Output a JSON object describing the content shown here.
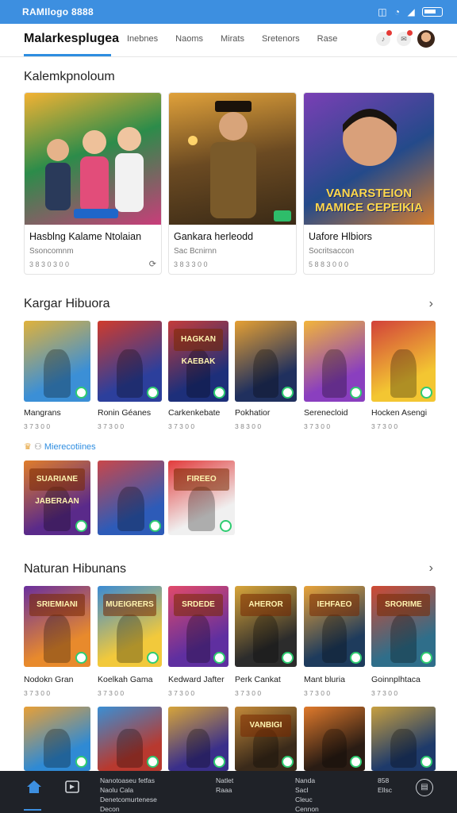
{
  "statusbar": {
    "left_text": "RAMIlogo 8888"
  },
  "brand": {
    "name": "Malarkesplugea"
  },
  "nav": {
    "links": [
      "Inebnes",
      "Naoms",
      "Mirats",
      "Sretenors",
      "Rase"
    ]
  },
  "featured": {
    "title": "Kalemkpnoloum",
    "cards": [
      {
        "title": "Hasblng Kalame Ntolaian",
        "sub": "Ssoncomnm",
        "meta": "3 8 3 0 3 0 0",
        "art_text": "",
        "colors": [
          "#2c8c4a",
          "#f3b233",
          "#c93d7a"
        ]
      },
      {
        "title": "Gankara herleodd",
        "sub": "Sac Bcnirnn",
        "meta": "3 8 3 3 0 0",
        "art_text": "",
        "colors": [
          "#3a2a16",
          "#e0a13a",
          "#6b4a22"
        ]
      },
      {
        "title": "Uafore Hlbiors",
        "sub": "Socritsaccon",
        "meta": "5 8 8 3 0 0 0",
        "art_text": "VANARSTEION MAMICE CEPEIKIA",
        "colors": [
          "#244a8a",
          "#7a3fb5",
          "#d47c2e"
        ]
      }
    ]
  },
  "row1": {
    "title": "Kargar Hibuora",
    "tiles": [
      {
        "label": "",
        "title": "Mangrans",
        "meta": "3 7 3 0 0",
        "colors": [
          "#3b8fd6",
          "#e0b23b"
        ]
      },
      {
        "label": "",
        "title": "Ronin Géanes",
        "meta": "3 7 3 0 0",
        "colors": [
          "#2c3f9c",
          "#d03b2c"
        ]
      },
      {
        "label": "HAGKAN KAEBAK",
        "title": "Carkenkebate",
        "meta": "3 7 3 0 0",
        "colors": [
          "#1d2f7a",
          "#c43c3a"
        ]
      },
      {
        "label": "",
        "title": "Pokhatior",
        "meta": "3 8 3 0 0",
        "colors": [
          "#20305e",
          "#e5a033"
        ]
      },
      {
        "label": "",
        "title": "Serenecloid",
        "meta": "3 7 3 0 0",
        "colors": [
          "#8a3fbf",
          "#f2b53a"
        ]
      },
      {
        "label": "",
        "title": "Hocken Asengi",
        "meta": "3 7 3 0 0",
        "colors": [
          "#f3c632",
          "#d2413a"
        ]
      }
    ]
  },
  "badge_row": {
    "text": "Mierecotiines"
  },
  "mini_tiles": [
    {
      "label": "SUARIANE JABERAAN",
      "colors": [
        "#5a2a8a",
        "#e07d2a"
      ]
    },
    {
      "label": "",
      "colors": [
        "#2d5bb8",
        "#c9474a"
      ]
    },
    {
      "label": "FIREEO",
      "colors": [
        "#f0f0f0",
        "#e23b3b"
      ]
    }
  ],
  "row2": {
    "title": "Naturan Hibunans",
    "tiles": [
      {
        "label": "SRIEMIANI",
        "title": "Nodokn Gran",
        "meta": "3 7 3 0 0",
        "colors": [
          "#e88a2c",
          "#6a2f9e"
        ]
      },
      {
        "label": "MUEIGRERS",
        "title": "Koelkah Gama",
        "meta": "3 7 3 0 0",
        "colors": [
          "#f2c93b",
          "#3a8bd4"
        ]
      },
      {
        "label": "SRDEDE",
        "title": "Kedward Jafter",
        "meta": "3 7 3 0 0",
        "colors": [
          "#5f2fa0",
          "#e14a6a"
        ]
      },
      {
        "label": "AHEROR",
        "title": "Perk Cankat",
        "meta": "3 7 3 0 0",
        "colors": [
          "#2c2c2c",
          "#d8a53a"
        ]
      },
      {
        "label": "IEHFAEO",
        "title": "Mant bluria",
        "meta": "3 7 3 0 0",
        "colors": [
          "#1e3b5c",
          "#e8a33a"
        ]
      },
      {
        "label": "SRORIME",
        "title": "Goinnplhtaca",
        "meta": "3 7 3 0 0",
        "colors": [
          "#2f6e8a",
          "#d04a33"
        ]
      }
    ]
  },
  "row3": {
    "tiles": [
      {
        "label": "",
        "colors": [
          "#2f8ad4",
          "#e9a036"
        ]
      },
      {
        "label": "",
        "colors": [
          "#b8392f",
          "#3a8fd4"
        ]
      },
      {
        "label": "",
        "colors": [
          "#3a2f8a",
          "#d7a53a"
        ]
      },
      {
        "label": "VANBIGI",
        "colors": [
          "#3a2a1a",
          "#c48a3a"
        ]
      },
      {
        "label": "",
        "colors": [
          "#2a1c14",
          "#e07a2c"
        ]
      },
      {
        "label": "",
        "colors": [
          "#1e3a6a",
          "#c8a040"
        ]
      }
    ]
  },
  "bottombar": {
    "col1": [
      "Nanotoaseu fetfas",
      "Naolu Cala",
      "Denetcomurtenese",
      "Decon"
    ],
    "col2": [
      "Natlet",
      "Raaa"
    ],
    "col3": [
      "Nanda",
      "Sacl",
      "Cleuc",
      "Cennon"
    ],
    "col4": [
      "858",
      "Ellsc"
    ]
  }
}
